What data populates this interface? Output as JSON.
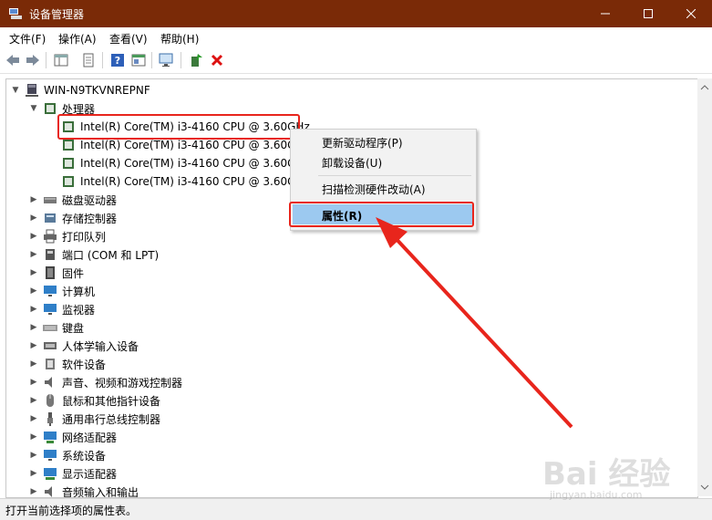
{
  "window": {
    "title": "设备管理器"
  },
  "menu": {
    "items": [
      "文件(F)",
      "操作(A)",
      "查看(V)",
      "帮助(H)"
    ]
  },
  "tree": {
    "root": "WIN-N9TKVNREPNF",
    "processor_label": "处理器",
    "cpus": [
      "Intel(R) Core(TM) i3-4160 CPU @ 3.60GHz",
      "Intel(R) Core(TM) i3-4160 CPU @ 3.60GHz",
      "Intel(R) Core(TM) i3-4160 CPU @ 3.60GHz",
      "Intel(R) Core(TM) i3-4160 CPU @ 3.60GHz"
    ],
    "categories": [
      {
        "label": "磁盘驱动器",
        "icon": "disk-drive-icon"
      },
      {
        "label": "存储控制器",
        "icon": "storage-controller-icon"
      },
      {
        "label": "打印队列",
        "icon": "printer-icon"
      },
      {
        "label": "端口 (COM 和 LPT)",
        "icon": "port-icon"
      },
      {
        "label": "固件",
        "icon": "firmware-icon"
      },
      {
        "label": "计算机",
        "icon": "computer-icon"
      },
      {
        "label": "监视器",
        "icon": "monitor-icon"
      },
      {
        "label": "键盘",
        "icon": "keyboard-icon"
      },
      {
        "label": "人体学输入设备",
        "icon": "hid-icon"
      },
      {
        "label": "软件设备",
        "icon": "software-device-icon"
      },
      {
        "label": "声音、视频和游戏控制器",
        "icon": "speaker-icon"
      },
      {
        "label": "鼠标和其他指针设备",
        "icon": "mouse-icon"
      },
      {
        "label": "通用串行总线控制器",
        "icon": "usb-icon"
      },
      {
        "label": "网络适配器",
        "icon": "network-adapter-icon"
      },
      {
        "label": "系统设备",
        "icon": "system-device-icon"
      },
      {
        "label": "显示适配器",
        "icon": "display-adapter-icon"
      },
      {
        "label": "音频输入和输出",
        "icon": "audio-io-icon"
      }
    ]
  },
  "context_menu": {
    "update_driver": "更新驱动程序(P)",
    "uninstall": "卸载设备(U)",
    "scan": "扫描检测硬件改动(A)",
    "properties": "属性(R)"
  },
  "status": {
    "text": "打开当前选择项的属性表。"
  },
  "watermark": {
    "logo": "Bai 经验",
    "url": "jingyan.baidu.com"
  },
  "colors": {
    "titlebar": "#7a2a07",
    "highlight": "#9cc9f0",
    "annotation": "#e8251c"
  }
}
